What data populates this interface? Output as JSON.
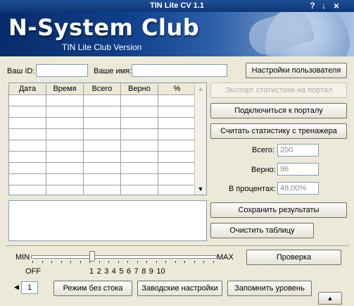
{
  "window": {
    "title": "TIN Lite CV 1.1",
    "help_icon": "?",
    "minimize_icon": "↓",
    "close_icon": "×"
  },
  "banner": {
    "logo": "N-System Club",
    "subtitle": "TIN Lite Club Version"
  },
  "user": {
    "id_label": "Ваш ID:",
    "id_value": "",
    "name_label": "Ваше имя:",
    "name_value": "",
    "settings_button": "Настройки пользователя"
  },
  "table": {
    "columns": [
      "Дата",
      "Время",
      "Всего",
      "Верно",
      "%"
    ],
    "row_count": 9
  },
  "actions": {
    "export_button": "Экспорт статистики на портал",
    "connect_button": "Подключиться к порталу",
    "read_button": "Считать статистику с тренажера"
  },
  "stats": {
    "total_label": "Всего:",
    "total_value": "200",
    "correct_label": "Верно:",
    "correct_value": "96",
    "percent_label": "В процентах:",
    "percent_value": "48,00%"
  },
  "results": {
    "save_button": "Сохранить результаты",
    "clear_button": "Очистить таблицу"
  },
  "level": {
    "min_label": "MIN",
    "max_label": "MAX",
    "off_label": "OFF",
    "tick_labels": [
      "1",
      "2",
      "3",
      "4",
      "5",
      "6",
      "7",
      "8",
      "9",
      "10"
    ],
    "current_level": 1,
    "check_button": "Проверка"
  },
  "bottom": {
    "spin_value": "1",
    "spin_left_icon": "◀",
    "nostop_button": "Режим без стока",
    "factory_button": "Заводские настройки",
    "remember_button": "Запомнить уровень",
    "collapse_icon": "▲"
  },
  "colors": {
    "title_bar": "#0e3677",
    "banner_dark": "#082c6b",
    "window_bg": "#ece9d8"
  }
}
